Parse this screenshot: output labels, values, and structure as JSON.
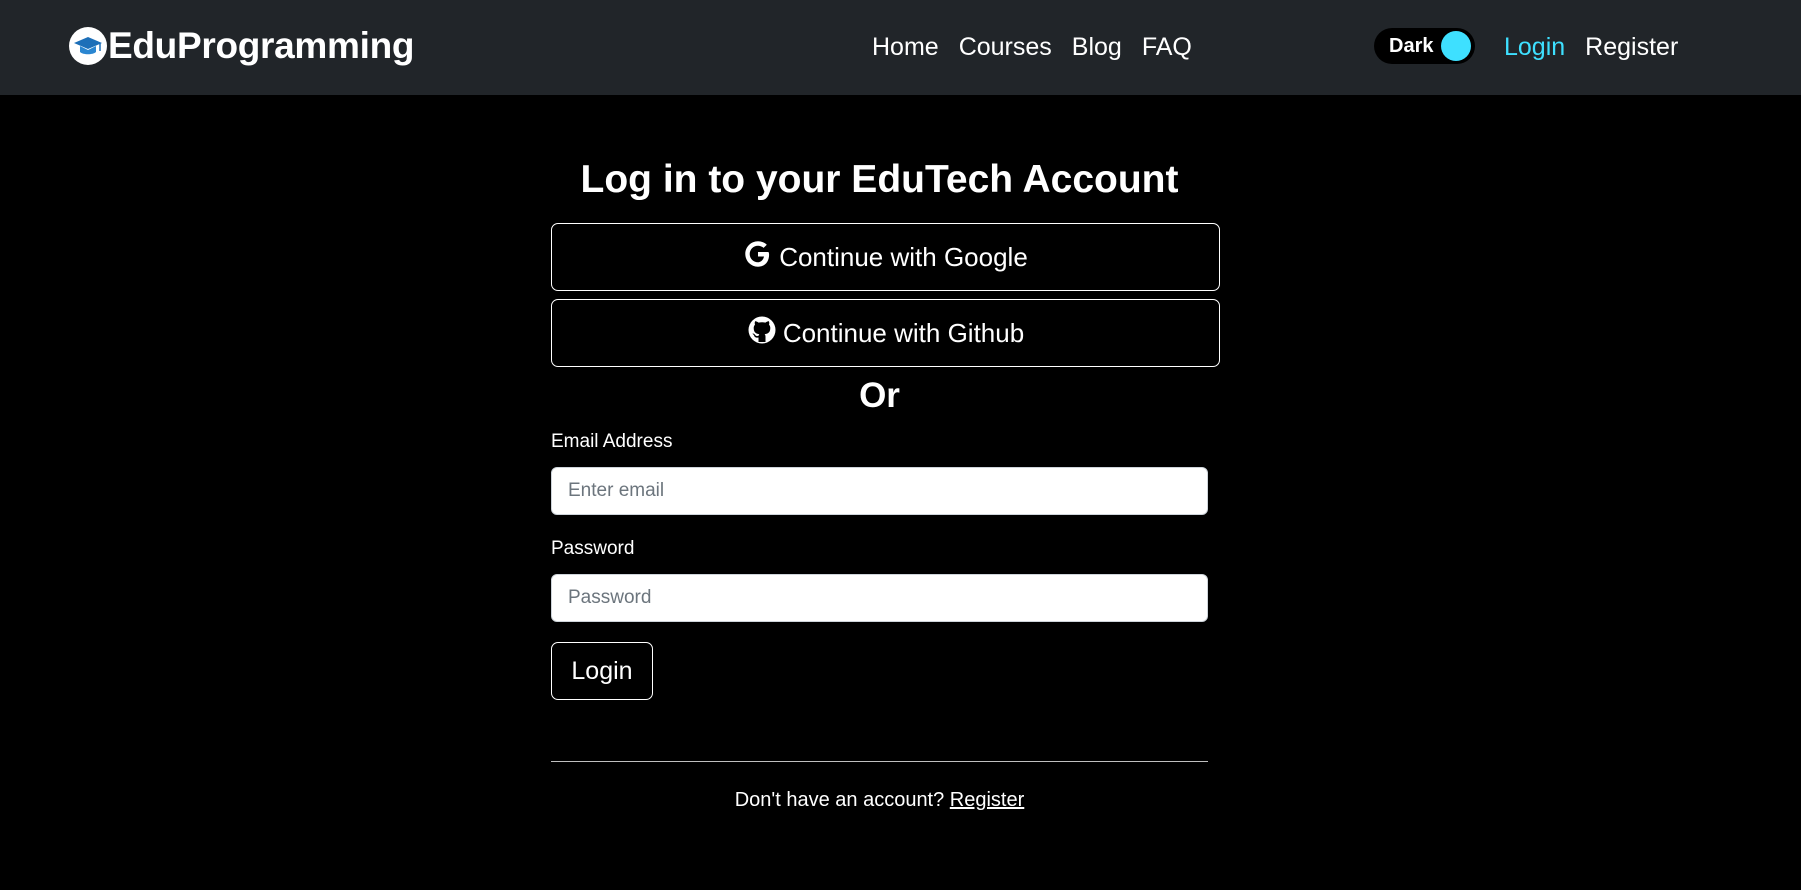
{
  "nav": {
    "brand": "EduProgramming",
    "links": [
      "Home",
      "Courses",
      "Blog",
      "FAQ"
    ],
    "theme_toggle_label": "Dark",
    "login": "Login",
    "register": "Register",
    "colors": {
      "background": "#212529",
      "active_link": "#3ee0ff",
      "toggle_knob": "#3ee0ff"
    }
  },
  "page": {
    "heading": "Log in to your EduTech Account",
    "google_button": "Continue with Google",
    "github_button": "Continue with Github",
    "separator": "Or",
    "email_label": "Email Address",
    "email_placeholder": "Enter email",
    "password_label": "Password",
    "password_placeholder": "Password",
    "login_button": "Login",
    "no_account_text": "Don't have an account? ",
    "register_link": "Register",
    "background": "#000000"
  },
  "icons": [
    "graduation-cap-icon",
    "google-icon",
    "github-icon"
  ]
}
